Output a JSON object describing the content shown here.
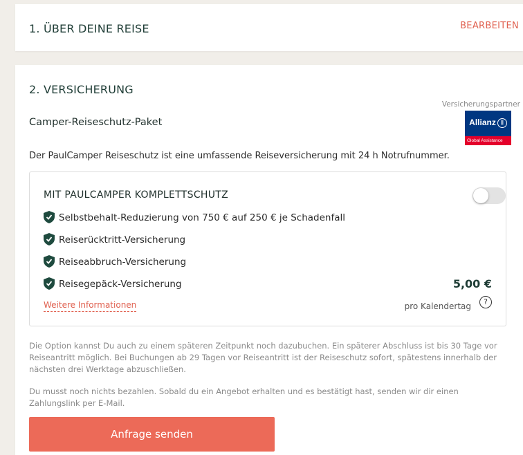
{
  "section1": {
    "title": "1. ÜBER DEINE REISE",
    "edit_label": "BEARBEITEN"
  },
  "section2": {
    "title": "2. VERSICHERUNG",
    "package_title": "Camper-Reiseschutz-Paket",
    "partner_label": "Versicherungspartner",
    "partner_logo": {
      "brand": "Allianz",
      "sub": "Global Assistance",
      "color": "#003781",
      "accent": "#e4002b"
    },
    "intro": "Der PaulCamper Reiseschutz ist eine umfassende Reiseversicherung mit 24 h Notrufnummer.",
    "option": {
      "title": "MIT PAULCAMPER KOMPLETTSCHUTZ",
      "toggle_on": false,
      "features": [
        "Selbstbehalt-Reduzierung von 750 € auf 250 € je Schadenfall",
        "Reiserücktritt-Versicherung",
        "Reiseabbruch-Versicherung",
        "Reisegepäck-Versicherung"
      ],
      "feature_icon": "shield-check-icon",
      "more_info_label": "Weitere Informationen",
      "price": "5,00 €",
      "price_unit": "pro Kalendertag",
      "help_icon_glyph": "?"
    },
    "note1": "Die Option kannst Du auch zu einem späteren Zeitpunkt noch dazubuchen. Ein späterer Abschluss ist bis 30 Tage vor Reiseantritt möglich. Bei Buchungen ab 29 Tagen vor Reiseantritt ist der Reiseschutz sofort, spätestens innerhalb der nächsten drei Werktage abzuschließen.",
    "note2": "Du musst noch nichts bezahlen. Sobald du ein Angebot erhalten und es bestätigt hast, senden wir dir einen Zahlungslink per E-Mail.",
    "submit_label": "Anfrage senden"
  },
  "colors": {
    "accent": "#ec6a58",
    "heading": "#1f3d36",
    "shield": "#1e4a3e",
    "background": "#f1eee9"
  }
}
